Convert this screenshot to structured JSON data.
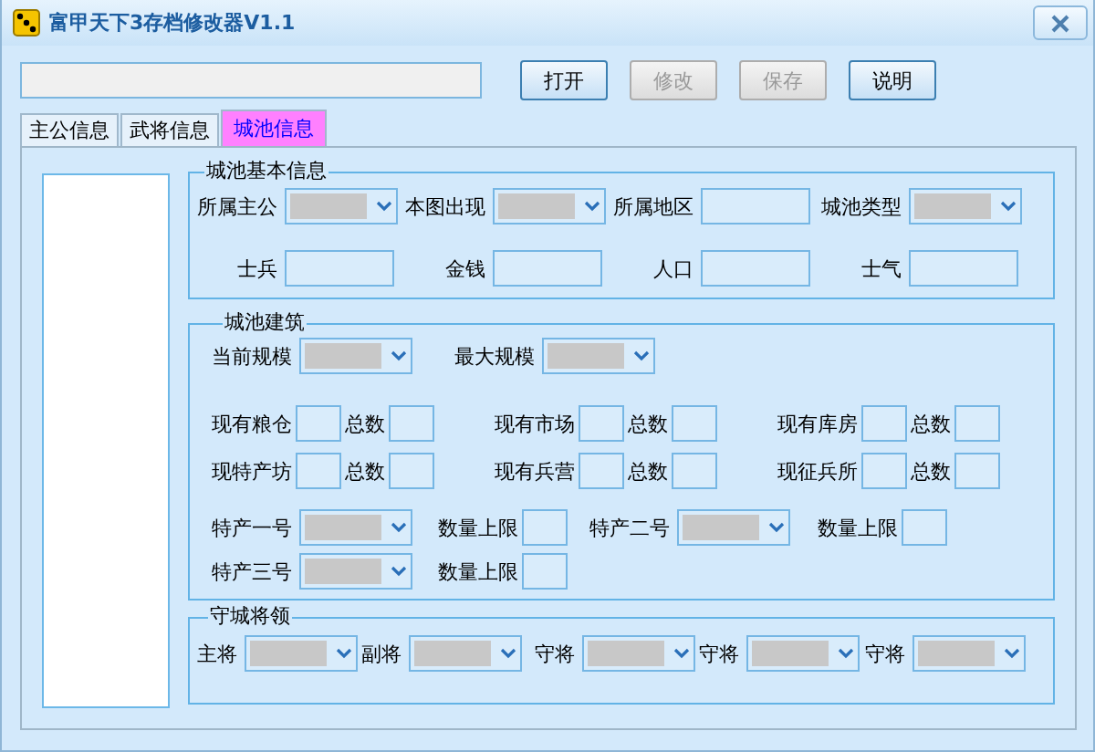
{
  "window": {
    "title": "富甲天下3存档修改器V1.1"
  },
  "buttons": [
    {
      "label": "打开",
      "disabled": false
    },
    {
      "label": "修改",
      "disabled": true
    },
    {
      "label": "保存",
      "disabled": true
    },
    {
      "label": "说明",
      "disabled": false
    }
  ],
  "tabs": [
    {
      "label": "主公信息",
      "selected": false
    },
    {
      "label": "武将信息",
      "selected": false
    },
    {
      "label": "城池信息",
      "selected": true
    }
  ],
  "groups": [
    {
      "title": "城池基本信息",
      "lines": [
        {
          "fields": [
            {
              "label": "所属主公",
              "kind": "combo"
            },
            {
              "label": "本图出现",
              "kind": "combo"
            },
            {
              "label": "所属地区",
              "kind": "text"
            },
            {
              "label": "城池类型",
              "kind": "combo"
            }
          ]
        },
        {
          "fields": [
            {
              "label": "士兵",
              "kind": "text"
            },
            {
              "label": "金钱",
              "kind": "text"
            },
            {
              "label": "人口",
              "kind": "text"
            },
            {
              "label": "士气",
              "kind": "text"
            }
          ]
        }
      ]
    },
    {
      "title": "城池建筑",
      "lines": [
        {
          "fields": [
            {
              "label": "当前规模",
              "kind": "combo"
            },
            {
              "label": "最大规模",
              "kind": "combo"
            }
          ]
        },
        {
          "fields": [
            {
              "label": "现有粮仓",
              "kind": "small"
            },
            {
              "label": "总数",
              "kind": "small"
            },
            {
              "label": "现有市场",
              "kind": "small"
            },
            {
              "label": "总数",
              "kind": "small"
            },
            {
              "label": "现有库房",
              "kind": "small"
            },
            {
              "label": "总数",
              "kind": "small"
            }
          ]
        },
        {
          "fields": [
            {
              "label": "现特产坊",
              "kind": "small"
            },
            {
              "label": "总数",
              "kind": "small"
            },
            {
              "label": "现有兵营",
              "kind": "small"
            },
            {
              "label": "总数",
              "kind": "small"
            },
            {
              "label": "现征兵所",
              "kind": "small"
            },
            {
              "label": "总数",
              "kind": "small"
            }
          ]
        },
        {
          "fields": [
            {
              "label": "特产一号",
              "kind": "combo"
            },
            {
              "label": "数量上限",
              "kind": "small"
            },
            {
              "label": "特产二号",
              "kind": "combo"
            },
            {
              "label": "数量上限",
              "kind": "small"
            }
          ]
        },
        {
          "fields": [
            {
              "label": "特产三号",
              "kind": "combo"
            },
            {
              "label": "数量上限",
              "kind": "small"
            }
          ]
        }
      ]
    },
    {
      "title": "守城将领",
      "lines": [
        {
          "fields": [
            {
              "label": "主将",
              "kind": "combo"
            },
            {
              "label": "副将",
              "kind": "combo"
            },
            {
              "label": "守将",
              "kind": "combo"
            },
            {
              "label": "守将",
              "kind": "combo"
            },
            {
              "label": "守将",
              "kind": "combo"
            }
          ]
        }
      ]
    }
  ]
}
